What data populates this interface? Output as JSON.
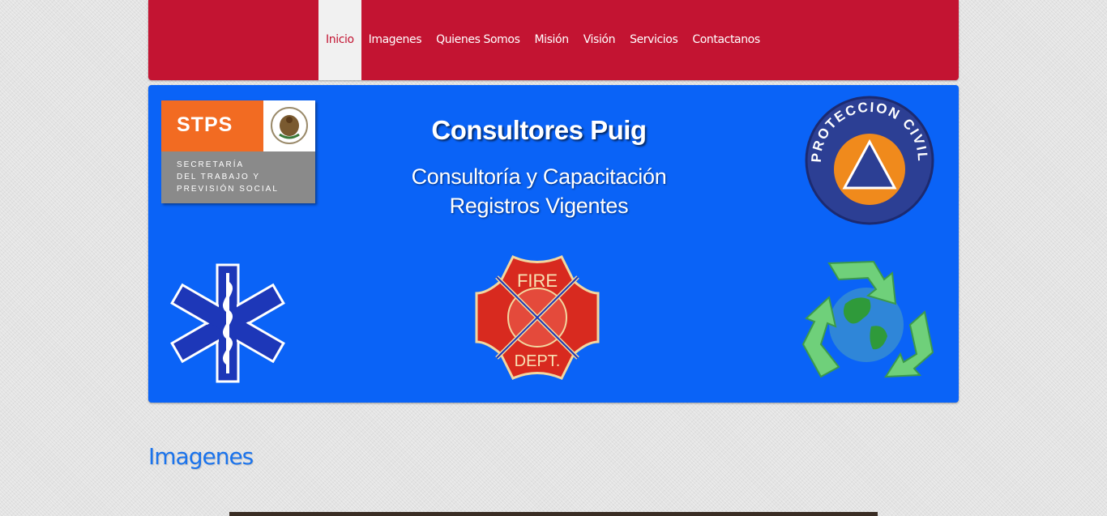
{
  "nav": {
    "items": [
      {
        "label": "Inicio",
        "active": true
      },
      {
        "label": "Imagenes"
      },
      {
        "label": "Quienes Somos"
      },
      {
        "label": "Misión"
      },
      {
        "label": "Visión"
      },
      {
        "label": "Servicios"
      },
      {
        "label": "Contactanos"
      }
    ]
  },
  "banner": {
    "stps": {
      "abbr": "STPS",
      "line1": "SECRETARÍA",
      "line2": "DEL TRABAJO Y",
      "line3": "PREVISIÓN SOCIAL"
    },
    "title": "Consultores Puig",
    "subtitle1": "Consultoría y Capacitación",
    "subtitle2": "Registros Vigentes",
    "proteccion_civil": "PROTECCION CIVIL",
    "fire_top": "FIRE",
    "fire_bottom": "DEPT."
  },
  "section": {
    "title": "Imagenes"
  },
  "colors": {
    "nav_bg": "#c31432",
    "banner_bg": "#0a63f7",
    "heading": "#1a73ec"
  }
}
